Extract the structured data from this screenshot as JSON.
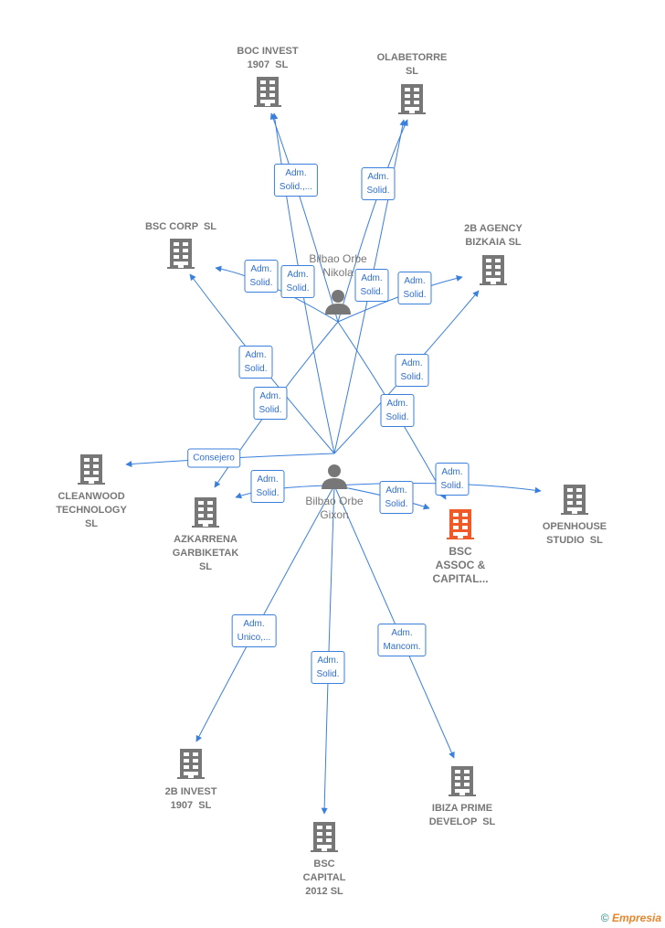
{
  "colors": {
    "edge": "#3a7fdc",
    "company": "#777777",
    "focus_company": "#f05a28",
    "person": "#777777"
  },
  "persons": [
    {
      "id": "nikola",
      "label": "Bilbao Orbe\nNikola",
      "icon": "person-icon"
    },
    {
      "id": "gixon",
      "label": "Bilbao Orbe\nGixon",
      "icon": "person-icon"
    }
  ],
  "companies": [
    {
      "id": "boc_invest",
      "label": "BOC INVEST\n1907  SL",
      "icon": "building-icon"
    },
    {
      "id": "olabetorre",
      "label": "OLABETORRE\nSL",
      "icon": "building-icon"
    },
    {
      "id": "bsc_corp",
      "label": "BSC CORP  SL",
      "icon": "building-icon"
    },
    {
      "id": "agency",
      "label": "2B AGENCY\nBIZKAIA SL",
      "icon": "building-icon"
    },
    {
      "id": "cleanwood",
      "label": "CLEANWOOD\nTECHNOLOGY\nSL",
      "icon": "building-icon"
    },
    {
      "id": "azkarrena",
      "label": "AZKARRENA\nGARBIKETAK\nSL",
      "icon": "building-icon"
    },
    {
      "id": "bsc_assoc",
      "label": "BSC\nASSOC &\nCAPITAL...",
      "icon": "building-icon",
      "focus": true
    },
    {
      "id": "openhouse",
      "label": "OPENHOUSE\nSTUDIO  SL",
      "icon": "building-icon"
    },
    {
      "id": "invest2b",
      "label": "2B INVEST\n1907  SL",
      "icon": "building-icon"
    },
    {
      "id": "bsc_capital",
      "label": "BSC\nCAPITAL\n2012 SL",
      "icon": "building-icon"
    },
    {
      "id": "ibiza",
      "label": "IBIZA PRIME\nDEVELOP  SL",
      "icon": "building-icon"
    }
  ],
  "edges": [
    {
      "from": "nikola",
      "to": "boc_invest",
      "label": "Adm.\nSolid.,..."
    },
    {
      "from": "gixon",
      "to": "boc_invest",
      "label": "Adm.\nSolid."
    },
    {
      "from": "nikola",
      "to": "olabetorre",
      "label": "Adm.\nSolid."
    },
    {
      "from": "gixon",
      "to": "olabetorre",
      "label": "Adm.\nSolid."
    },
    {
      "from": "nikola",
      "to": "bsc_corp",
      "label": "Adm.\nSolid."
    },
    {
      "from": "nikola",
      "to": "agency",
      "label": "Adm.\nSolid."
    },
    {
      "from": "gixon",
      "to": "bsc_corp",
      "label": "Adm.\nSolid."
    },
    {
      "from": "nikola",
      "to": "azkarrena",
      "label": "Adm.\nSolid."
    },
    {
      "from": "gixon",
      "to": "cleanwood",
      "label": "Consejero"
    },
    {
      "from": "gixon",
      "to": "azkarrena",
      "label": "Adm.\nSolid."
    },
    {
      "from": "gixon",
      "to": "agency",
      "label": "Adm.\nSolid."
    },
    {
      "from": "nikola",
      "to": "bsc_assoc",
      "label": "Adm.\nSolid."
    },
    {
      "from": "gixon",
      "to": "openhouse",
      "label": "Adm.\nSolid."
    },
    {
      "from": "gixon",
      "to": "bsc_assoc",
      "label": "Adm.\nSolid."
    },
    {
      "from": "gixon",
      "to": "invest2b",
      "label": "Adm.\nUnico,..."
    },
    {
      "from": "gixon",
      "to": "bsc_capital",
      "label": "Adm.\nSolid."
    },
    {
      "from": "gixon",
      "to": "ibiza",
      "label": "Adm.\nMancom."
    }
  ],
  "footer": {
    "copyright": "©",
    "brand": "Empresia"
  }
}
